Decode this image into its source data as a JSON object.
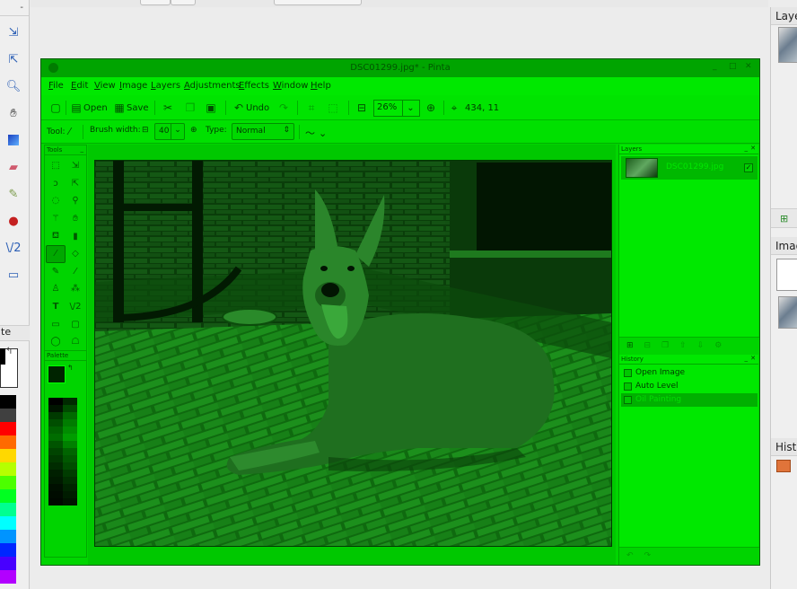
{
  "pinta": {
    "title": "DSC01299.jpg* - Pinta",
    "menu": [
      "File",
      "Edit",
      "View",
      "Image",
      "Layers",
      "Adjustments",
      "Effects",
      "Window",
      "Help"
    ],
    "toolbar": {
      "open_label": "Open",
      "save_label": "Save",
      "undo_label": "Undo",
      "zoom_value": "26%",
      "cursor_position": "434, 11"
    },
    "tool_options": {
      "tool_label": "Tool:",
      "brush_width_label": "Brush width:",
      "brush_width_value": "40",
      "type_label": "Type:",
      "type_value": "Normal"
    },
    "tools_panel": {
      "title": "Tools"
    },
    "palette_panel": {
      "title": "Palette"
    },
    "layers_panel": {
      "title": "Layers",
      "layers": [
        {
          "name": "DSC01299.jpg",
          "visible": true
        }
      ]
    },
    "history_panel": {
      "title": "History",
      "items": [
        {
          "label": "Open Image",
          "selected": false
        },
        {
          "label": "Auto Level",
          "selected": false
        },
        {
          "label": "Oil Painting",
          "selected": true
        }
      ]
    }
  },
  "host": {
    "left_panel_close": "-",
    "palette_header": "te",
    "right_headers": [
      "Laye",
      "Imag",
      "Histo"
    ]
  },
  "colors": {
    "tint": "#00d600",
    "host_bg": "#ececec"
  }
}
